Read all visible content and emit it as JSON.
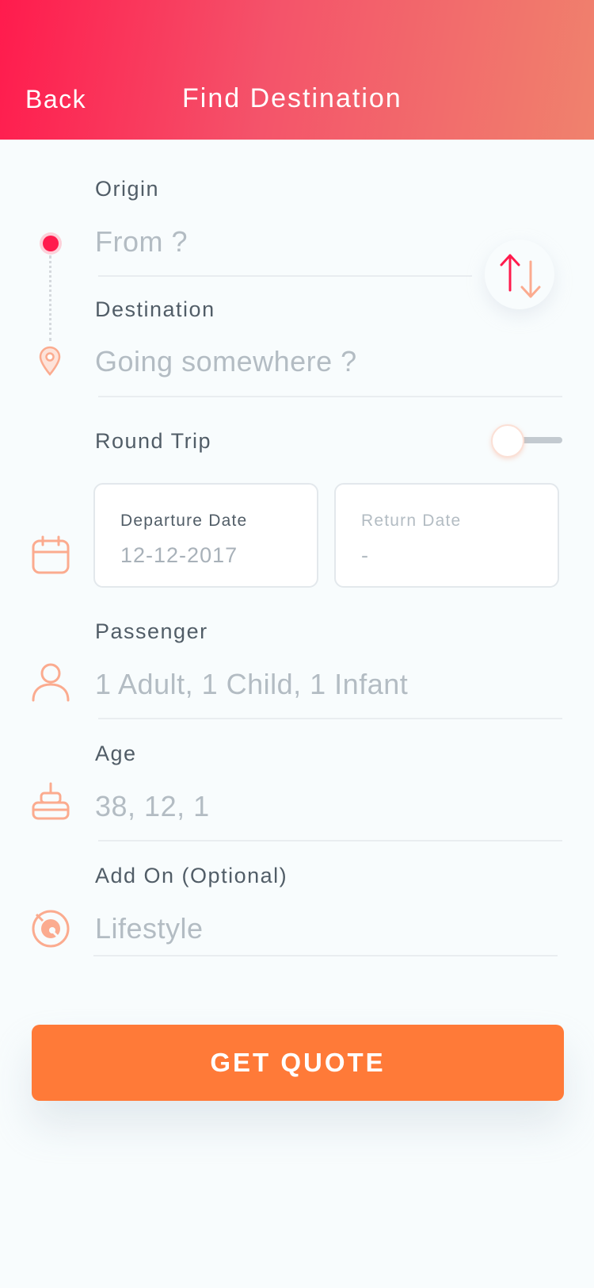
{
  "header": {
    "back_label": "Back",
    "title": "Find Destination"
  },
  "form": {
    "origin": {
      "label": "Origin",
      "placeholder": "From ?"
    },
    "destination": {
      "label": "Destination",
      "placeholder": "Going somewhere ?"
    },
    "round_trip": {
      "label": "Round Trip",
      "enabled": false
    },
    "departure_date": {
      "label": "Departure Date",
      "value": "12-12-2017"
    },
    "return_date": {
      "label": "Return Date",
      "value": "-"
    },
    "passenger": {
      "label": "Passenger",
      "value": "1 Adult, 1 Child, 1 Infant"
    },
    "age": {
      "label": "Age",
      "value": "38, 12, 1"
    },
    "add_on": {
      "label": "Add On (Optional)",
      "value": "Lifestyle"
    }
  },
  "actions": {
    "get_quote_label": "GET QUOTE"
  },
  "icons": {
    "origin": "origin-dot-icon",
    "destination": "map-pin-icon",
    "swap": "swap-arrows-icon",
    "date": "calendar-icon",
    "passenger": "person-icon",
    "age": "cake-icon",
    "add_on": "lifebuoy-icon"
  },
  "colors": {
    "header_gradient_start": "#ff1b4d",
    "header_gradient_end": "#f0826d",
    "accent_red": "#ff1b4d",
    "icon_peach": "#fbab8f",
    "button_orange": "#ff7a38",
    "label_text": "#515d67",
    "placeholder_text": "#b3bcc3"
  }
}
